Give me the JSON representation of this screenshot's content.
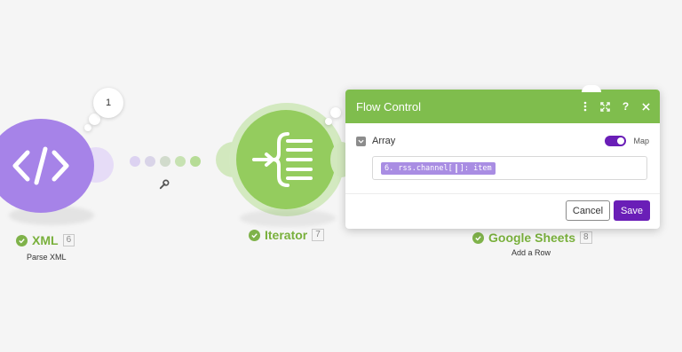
{
  "canvas": {
    "background": "#f5f5f5",
    "modules": {
      "xml": {
        "name": "XML",
        "id": "6",
        "subtitle": "Parse XML",
        "color": "#a683e8",
        "bubble_count": "1",
        "icon": "code-icon"
      },
      "iterator": {
        "name": "Iterator",
        "id": "7",
        "color": "#94cc5e",
        "icon": "iterator-icon"
      },
      "sheets": {
        "name": "Google Sheets",
        "id": "8",
        "subtitle": "Add a Row",
        "color": "#79b03c"
      }
    },
    "connector": {
      "dot_colors": [
        "#dcd2f1",
        "#d9d4e8",
        "#d1dbcc",
        "#c7e2b2",
        "#b6dc96"
      ],
      "tool_icon": "wrench-icon"
    }
  },
  "panel": {
    "title": "Flow Control",
    "header_color": "#7fbd4d",
    "header_icons": [
      "more-vertical-icon",
      "expand-icon",
      "help-icon",
      "close-icon"
    ],
    "field": {
      "label": "Array",
      "map_label": "Map",
      "map_enabled": true,
      "value_pill": {
        "part1": "6. rss.channel[",
        "part2": "]: item"
      }
    },
    "buttons": {
      "cancel": "Cancel",
      "save": "Save"
    },
    "accent": "#6a1eb7"
  }
}
